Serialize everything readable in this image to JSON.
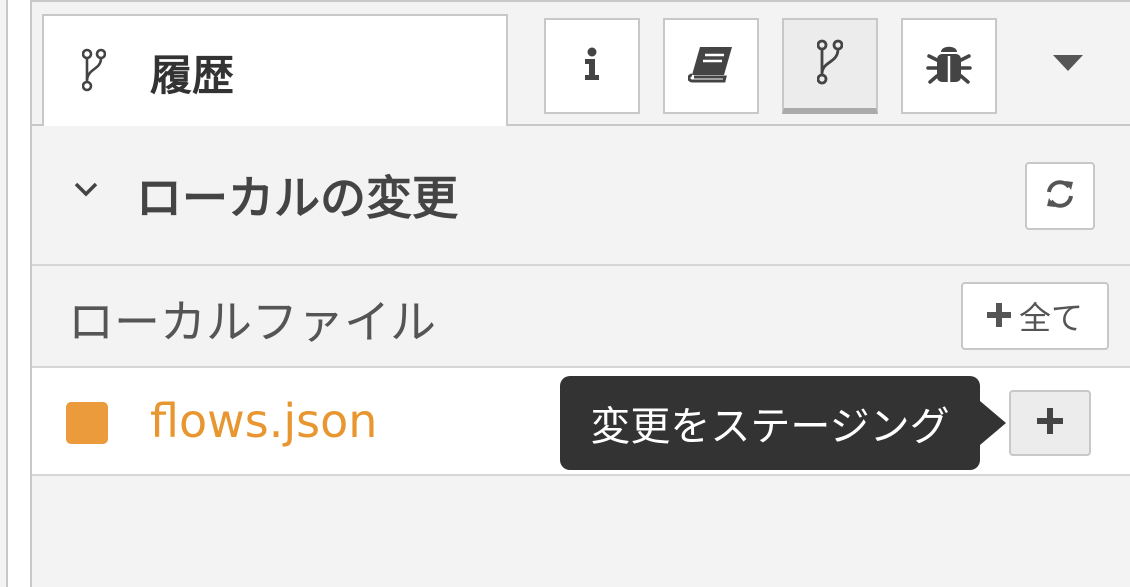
{
  "tabs": {
    "active_label": "履歴",
    "active_icon": "git-branch-icon",
    "buttons": [
      {
        "icon": "info-icon"
      },
      {
        "icon": "book-icon"
      },
      {
        "icon": "git-branch-icon",
        "selected": true
      },
      {
        "icon": "bug-icon"
      }
    ],
    "menu_icon": "caret-down-icon"
  },
  "section": {
    "title": "ローカルの変更",
    "expanded": true,
    "refresh_icon": "refresh-icon"
  },
  "local_files": {
    "label": "ローカルファイル",
    "stage_all_label": "全て"
  },
  "files": [
    {
      "name": "flows.json",
      "status_color": "#ec9b3c"
    }
  ],
  "tooltip": {
    "text": "変更をステージング"
  },
  "colors": {
    "file_modified": "#e8962f",
    "tooltip_bg": "#333333",
    "border": "#c8c8c8"
  }
}
